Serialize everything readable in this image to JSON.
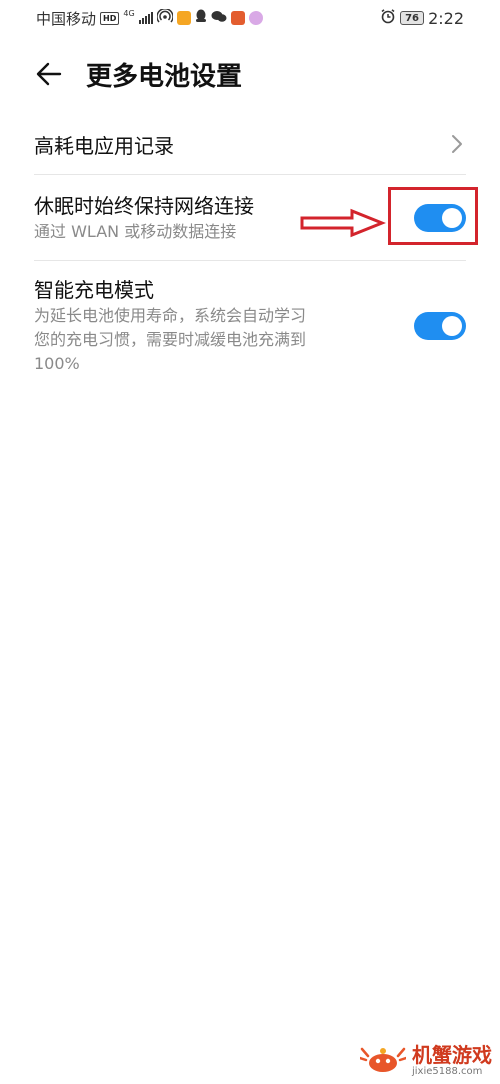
{
  "status_bar": {
    "carrier": "中国移动",
    "hd_badge": "HD",
    "network_badge": "4G",
    "battery_level": "76",
    "time": "2:22",
    "icons": [
      "signal-icon",
      "hotspot-icon",
      "weibo-icon",
      "qq-icon",
      "wechat-icon",
      "app-icon",
      "app-icon",
      "alarm-icon",
      "battery-icon"
    ]
  },
  "header": {
    "title": "更多电池设置",
    "back_icon": "arrow-left-icon"
  },
  "settings": {
    "items": [
      {
        "title": "高耗电应用记录",
        "subtitle": "",
        "control": "chevron"
      },
      {
        "title": "休眠时始终保持网络连接",
        "subtitle": "通过 WLAN 或移动数据连接",
        "control": "toggle",
        "enabled": true
      },
      {
        "title": "智能充电模式",
        "subtitle_lines": [
          "为延长电池使用寿命，系统会自动学习",
          "您的充电习惯，需要时减缓电池充满到",
          "100%"
        ],
        "control": "toggle",
        "enabled": true
      }
    ]
  },
  "watermark": {
    "title": "机蟹游戏",
    "url": "jixie5188.com"
  },
  "colors": {
    "toggle_on": "#1f8ef1",
    "annotation_red": "#d3242c",
    "subtitle_gray": "#8a8a8a"
  }
}
